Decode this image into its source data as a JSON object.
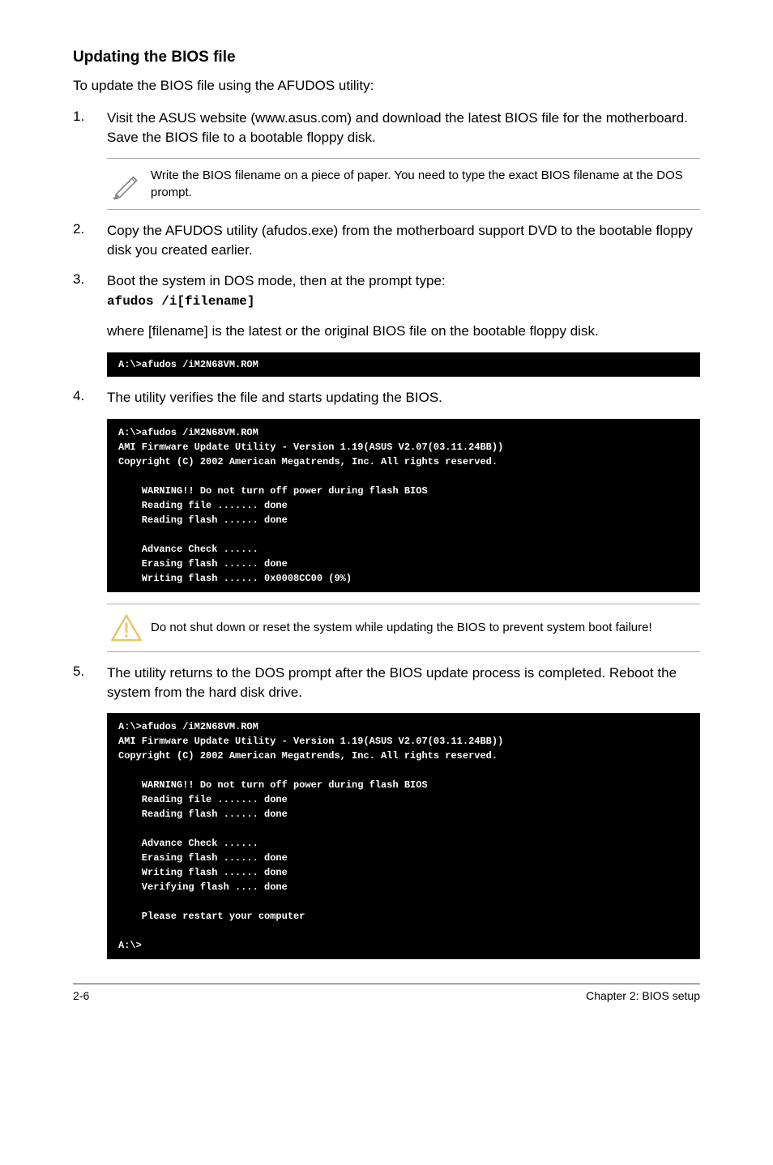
{
  "heading": "Updating the BIOS file",
  "intro": "To update the BIOS file using the AFUDOS utility:",
  "steps": {
    "step1": {
      "num": "1.",
      "text": "Visit the ASUS website (www.asus.com) and download the latest BIOS file for the motherboard. Save the BIOS file to a bootable floppy disk."
    },
    "note1": "Write the BIOS filename on a piece of paper. You need to type the exact BIOS filename at the DOS prompt.",
    "step2": {
      "num": "2.",
      "text": "Copy the AFUDOS utility (afudos.exe) from the motherboard support DVD to the bootable floppy disk you created earlier."
    },
    "step3": {
      "num": "3.",
      "text": "Boot the system in DOS mode, then at the prompt type:",
      "code": "afudos /i[filename]"
    },
    "step3note": "where [filename] is the latest or the original BIOS file on the bootable floppy disk.",
    "terminal1": "A:\\>afudos /iM2N68VM.ROM",
    "step4": {
      "num": "4.",
      "text": "The utility verifies the file and starts updating the BIOS."
    },
    "terminal2": "A:\\>afudos /iM2N68VM.ROM\nAMI Firmware Update Utility - Version 1.19(ASUS V2.07(03.11.24BB))\nCopyright (C) 2002 American Megatrends, Inc. All rights reserved.\n\n    WARNING!! Do not turn off power during flash BIOS\n    Reading file ....... done\n    Reading flash ...... done\n\n    Advance Check ......\n    Erasing flash ...... done\n    Writing flash ...... 0x0008CC00 (9%)",
    "warning1": "Do not shut down or reset the system while updating the BIOS to prevent system boot failure!",
    "step5": {
      "num": "5.",
      "text": "The utility returns to the DOS prompt after the BIOS update process is completed. Reboot the system from the hard disk drive."
    },
    "terminal3": "A:\\>afudos /iM2N68VM.ROM\nAMI Firmware Update Utility - Version 1.19(ASUS V2.07(03.11.24BB))\nCopyright (C) 2002 American Megatrends, Inc. All rights reserved.\n\n    WARNING!! Do not turn off power during flash BIOS\n    Reading file ....... done\n    Reading flash ...... done\n\n    Advance Check ......\n    Erasing flash ...... done\n    Writing flash ...... done\n    Verifying flash .... done\n\n    Please restart your computer\n\nA:\\>"
  },
  "footer": {
    "left": "2-6",
    "right": "Chapter 2: BIOS setup"
  }
}
